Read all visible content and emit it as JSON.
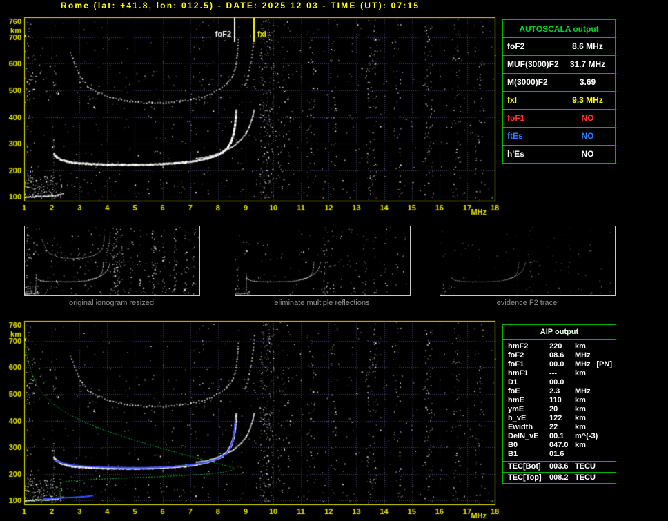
{
  "title": "Rome (lat: +41.8, lon: 012.5) - DATE: 2025 12 03 - TIME (UT): 07:15",
  "colors": {
    "background": "#000000",
    "title": "#ffff00",
    "axis": "#e8e800",
    "grid": "#3f3f6e",
    "trace_white": "#ffffff",
    "profile_green": "#00bb33",
    "restored_blue": "#3a4cff",
    "table_green": "#00b400",
    "value_red": "#ff3232",
    "value_blue": "#2f7fff",
    "value_yellow": "#ffff00",
    "caption_gray": "#8f8f8f"
  },
  "captions": [
    "original ionogram resized",
    "eliminate multiple reflections",
    "evidence F2 trace"
  ],
  "autoscala_table": {
    "title": "AUTOSCALA output",
    "rows": [
      {
        "label": "foF2",
        "value": "8.6 MHz",
        "color": "#ffffff"
      },
      {
        "label": "MUF(3000)F2",
        "value": "31.7 MHz",
        "color": "#ffffff"
      },
      {
        "label": "M(3000)F2",
        "value": "3.69",
        "color": "#ffffff"
      },
      {
        "label": "fxI",
        "value": "9.3 MHz",
        "color": "#ffff00"
      },
      {
        "label": "foF1",
        "value": "NO",
        "color": "#ff3232"
      },
      {
        "label": "ftEs",
        "value": "NO",
        "color": "#2f7fff"
      },
      {
        "label": "h'Es",
        "value": "NO",
        "color": "#ffffff"
      }
    ]
  },
  "aip_table": {
    "title": "AIP output",
    "rows": [
      {
        "name": "hmF2",
        "value": "220",
        "unit": "km"
      },
      {
        "name": "foF2",
        "value": "08.6",
        "unit": "MHz"
      },
      {
        "name": "foF1",
        "value": "00.0",
        "unit": "MHz",
        "extra": "[PN]"
      },
      {
        "name": "hmF1",
        "value": "---",
        "unit": "km"
      },
      {
        "name": "D1",
        "value": "00.0",
        "unit": ""
      },
      {
        "name": "foE",
        "value": "2.3",
        "unit": "MHz"
      },
      {
        "name": "hmE",
        "value": "110",
        "unit": "km"
      },
      {
        "name": "ymE",
        "value": "20",
        "unit": "km"
      },
      {
        "name": "h_vE",
        "value": "122",
        "unit": "km"
      },
      {
        "name": "Ewidth",
        "value": "22",
        "unit": "km"
      },
      {
        "name": "DelN_vE",
        "value": "00.1",
        "unit": "m^(-3)"
      },
      {
        "name": "B0",
        "value": "047.0",
        "unit": "km"
      },
      {
        "name": "B1",
        "value": "01.6",
        "unit": ""
      }
    ],
    "tec_rows": [
      {
        "name": "TEC[Bot]",
        "value": "003.6",
        "unit": "TECU"
      },
      {
        "name": "TEC[Top]",
        "value": "008.2",
        "unit": "TECU"
      }
    ]
  },
  "chart_data": {
    "type": "scatter",
    "title": "ionogram (virtual height vs frequency)",
    "x_label": "MHz",
    "y_label": "km",
    "x_range": [
      1,
      18
    ],
    "y_range": [
      85,
      775
    ],
    "x_ticks": [
      1,
      2,
      3,
      4,
      5,
      6,
      7,
      8,
      9,
      10,
      11,
      12,
      13,
      14,
      15,
      16,
      17,
      18
    ],
    "y_ticks": [
      760,
      700,
      600,
      500,
      400,
      300,
      200,
      100
    ],
    "y_grid": [
      100,
      200,
      300,
      400,
      500,
      600,
      700
    ],
    "markers": [
      {
        "label": "foF2",
        "x": 8.6,
        "color": "#ffffff",
        "side": "left"
      },
      {
        "label": "fxI",
        "x": 9.3,
        "color": "#ffff00",
        "side": "right"
      }
    ],
    "traces": [
      {
        "id": "e-trace",
        "color": "#ffffff",
        "size": 2,
        "step": 2,
        "jitter": 0.7,
        "points": [
          [
            1.0,
            102
          ],
          [
            1.35,
            103
          ],
          [
            1.7,
            105
          ],
          [
            2.0,
            107
          ],
          [
            2.2,
            109
          ],
          [
            2.4,
            114
          ]
        ]
      },
      {
        "id": "ef-cusp",
        "color": "#ffffff",
        "size": 1,
        "step": 4,
        "jitter": 1.2,
        "fade": 0.85,
        "points": [
          [
            2.02,
            118
          ],
          [
            2.03,
            150
          ],
          [
            2.05,
            185
          ],
          [
            2.06,
            222
          ],
          [
            2.06,
            255
          ],
          [
            2.07,
            288
          ],
          [
            2.04,
            312
          ]
        ]
      },
      {
        "id": "f-trace-o",
        "color": "#ffffff",
        "size": 3,
        "step": 2,
        "jitter": 0.7,
        "points": [
          [
            2.05,
            265
          ],
          [
            2.15,
            252
          ],
          [
            2.3,
            243
          ],
          [
            2.5,
            236
          ],
          [
            2.8,
            231
          ],
          [
            3.2,
            228
          ],
          [
            3.6,
            226
          ],
          [
            4.0,
            225
          ],
          [
            4.5,
            224
          ],
          [
            5.0,
            224
          ],
          [
            5.5,
            225
          ],
          [
            6.0,
            227
          ],
          [
            6.4,
            229
          ],
          [
            6.8,
            233
          ],
          [
            7.2,
            239
          ],
          [
            7.6,
            248
          ],
          [
            7.9,
            259
          ],
          [
            8.15,
            272
          ],
          [
            8.33,
            290
          ],
          [
            8.45,
            312
          ],
          [
            8.53,
            340
          ],
          [
            8.58,
            372
          ],
          [
            8.61,
            402
          ],
          [
            8.63,
            428
          ]
        ]
      },
      {
        "id": "f-trace-x",
        "color": "#ffffff",
        "size": 2,
        "step": 2,
        "jitter": 0.7,
        "points": [
          [
            7.2,
            246
          ],
          [
            7.7,
            256
          ],
          [
            8.1,
            269
          ],
          [
            8.45,
            287
          ],
          [
            8.75,
            311
          ],
          [
            9.0,
            341
          ],
          [
            9.14,
            373
          ],
          [
            9.23,
            403
          ],
          [
            9.29,
            432
          ]
        ]
      },
      {
        "id": "hop2-tail",
        "color": "#ffffff",
        "size": 2,
        "step": 5,
        "jitter": 1.4,
        "fade": 0.8,
        "points": [
          [
            2.65,
            645
          ],
          [
            2.8,
            602
          ],
          [
            2.95,
            566
          ],
          [
            3.1,
            539
          ],
          [
            3.3,
            516
          ]
        ]
      },
      {
        "id": "hop2",
        "color": "#ffffff",
        "size": 2,
        "step": 4,
        "jitter": 1.2,
        "fade": 0.85,
        "points": [
          [
            3.3,
            516
          ],
          [
            3.7,
            492
          ],
          [
            4.1,
            476
          ],
          [
            4.6,
            464
          ],
          [
            5.1,
            458
          ],
          [
            5.6,
            456
          ],
          [
            6.1,
            457
          ],
          [
            6.6,
            461
          ],
          [
            7.0,
            468
          ],
          [
            7.4,
            478
          ],
          [
            7.75,
            491
          ],
          [
            8.05,
            507
          ],
          [
            8.3,
            527
          ],
          [
            8.5,
            554
          ],
          [
            8.62,
            592
          ],
          [
            8.68,
            642
          ],
          [
            8.72,
            702
          ]
        ]
      },
      {
        "id": "hop2-x",
        "color": "#ffffff",
        "size": 2,
        "step": 5,
        "jitter": 1.4,
        "fade": 0.8,
        "points": [
          [
            8.95,
            520
          ],
          [
            9.08,
            562
          ],
          [
            9.18,
            612
          ],
          [
            9.25,
            667
          ],
          [
            9.3,
            722
          ]
        ]
      },
      {
        "id": "profile-green",
        "render": "line",
        "color": "#00bb33",
        "size": 1,
        "dash": [
          2,
          2
        ],
        "points": [
          [
            1.02,
            700
          ],
          [
            1.1,
            640
          ],
          [
            1.25,
            585
          ],
          [
            1.45,
            535
          ],
          [
            1.75,
            492
          ],
          [
            2.1,
            458
          ],
          [
            2.6,
            424
          ],
          [
            3.2,
            394
          ],
          [
            3.9,
            364
          ],
          [
            4.7,
            336
          ],
          [
            5.5,
            310
          ],
          [
            6.3,
            286
          ],
          [
            7.1,
            263
          ],
          [
            7.8,
            244
          ],
          [
            8.3,
            230
          ],
          [
            8.55,
            223
          ],
          [
            8.6,
            220
          ],
          [
            8.5,
            213
          ],
          [
            8.2,
            206
          ],
          [
            7.6,
            199
          ],
          [
            6.8,
            194
          ],
          [
            5.8,
            189
          ],
          [
            4.8,
            185
          ],
          [
            3.9,
            181
          ],
          [
            3.2,
            177
          ],
          [
            2.7,
            174
          ],
          [
            2.45,
            170
          ],
          [
            2.33,
            163
          ],
          [
            2.3,
            152
          ],
          [
            2.29,
            138
          ],
          [
            2.3,
            124
          ],
          [
            2.28,
            116
          ],
          [
            2.2,
            111
          ],
          [
            2.0,
            107
          ],
          [
            1.7,
            103
          ],
          [
            1.4,
            99
          ],
          [
            1.15,
            95
          ],
          [
            1.02,
            92
          ]
        ]
      },
      {
        "id": "restored-blue",
        "render": "line",
        "color": "#3a4cff",
        "size": 2,
        "points": [
          [
            2.1,
            252
          ],
          [
            2.4,
            240
          ],
          [
            2.8,
            232
          ],
          [
            3.3,
            228
          ],
          [
            3.9,
            225
          ],
          [
            4.6,
            223
          ],
          [
            5.3,
            223
          ],
          [
            6.0,
            225
          ],
          [
            6.6,
            229
          ],
          [
            7.1,
            235
          ],
          [
            7.6,
            244
          ],
          [
            8.0,
            257
          ],
          [
            8.3,
            275
          ],
          [
            8.45,
            298
          ],
          [
            8.55,
            330
          ],
          [
            8.6,
            368
          ],
          [
            8.63,
            405
          ]
        ]
      },
      {
        "id": "restored-blue-e",
        "render": "line",
        "color": "#3a4cff",
        "size": 2,
        "points": [
          [
            1.7,
            106
          ],
          [
            2.2,
            109
          ],
          [
            2.7,
            111
          ],
          [
            3.2,
            114
          ],
          [
            3.5,
            118
          ]
        ]
      }
    ],
    "noise": {
      "seed": 1337,
      "bands": [
        {
          "x0": 1.0,
          "x1": 18.0,
          "y0": 90,
          "y1": 770,
          "n": 420
        },
        {
          "x0": 9.5,
          "x1": 10.0,
          "y0": 90,
          "y1": 770,
          "n": 230
        },
        {
          "x0": 10.05,
          "x1": 10.6,
          "y0": 90,
          "y1": 770,
          "n": 70
        },
        {
          "x0": 11.2,
          "x1": 11.5,
          "y0": 90,
          "y1": 770,
          "n": 55
        },
        {
          "x0": 12.05,
          "x1": 12.3,
          "y0": 90,
          "y1": 770,
          "n": 40
        },
        {
          "x0": 13.35,
          "x1": 13.75,
          "y0": 90,
          "y1": 770,
          "n": 110
        },
        {
          "x0": 14.35,
          "x1": 14.6,
          "y0": 90,
          "y1": 770,
          "n": 45
        },
        {
          "x0": 15.45,
          "x1": 15.75,
          "y0": 90,
          "y1": 770,
          "n": 85
        },
        {
          "x0": 16.45,
          "x1": 16.75,
          "y0": 90,
          "y1": 770,
          "n": 60
        },
        {
          "x0": 17.25,
          "x1": 17.55,
          "y0": 90,
          "y1": 770,
          "n": 45
        },
        {
          "x0": 1.0,
          "x1": 2.35,
          "y0": 93,
          "y1": 185,
          "n": 150
        },
        {
          "x0": 1.0,
          "x1": 1.3,
          "y0": 90,
          "y1": 770,
          "n": 55
        },
        {
          "x0": 1.05,
          "x1": 2.4,
          "y0": 460,
          "y1": 640,
          "n": 45
        },
        {
          "x0": 3.0,
          "x1": 9.4,
          "y0": 430,
          "y1": 560,
          "n": 60
        },
        {
          "x0": 2.5,
          "x1": 9.0,
          "y0": 95,
          "y1": 200,
          "n": 40
        }
      ]
    }
  },
  "plots": {
    "top": {
      "canvas": "plot-top",
      "axes": true,
      "markers": true,
      "noise": 1,
      "dot_scale": 1,
      "dim": 1,
      "traces": [
        "e-trace",
        "ef-cusp",
        "f-trace-o",
        "f-trace-x",
        "hop2-tail",
        "hop2",
        "hop2-x"
      ]
    },
    "bottom": {
      "canvas": "plot-bottom",
      "axes": true,
      "markers": false,
      "noise": 1,
      "dot_scale": 1,
      "dim": 1,
      "traces": [
        "e-trace",
        "ef-cusp",
        "f-trace-o",
        "f-trace-x",
        "hop2-tail",
        "hop2",
        "hop2-x",
        "profile-green",
        "restored-blue",
        "restored-blue-e"
      ]
    },
    "thumb1": {
      "canvas": "thumb1-canvas",
      "axes": false,
      "markers": false,
      "noise": 0.35,
      "dot_scale": 0.45,
      "dim": 1,
      "traces": [
        "e-trace",
        "ef-cusp",
        "f-trace-o",
        "f-trace-x",
        "hop2-tail",
        "hop2",
        "hop2-x"
      ]
    },
    "thumb2": {
      "canvas": "thumb2-canvas",
      "axes": false,
      "markers": false,
      "noise": 0.15,
      "dot_scale": 0.45,
      "dim": 0.95,
      "traces": [
        "e-trace",
        "ef-cusp",
        "f-trace-o",
        "f-trace-x"
      ]
    },
    "thumb3": {
      "canvas": "thumb3-canvas",
      "axes": false,
      "markers": false,
      "noise": 0.08,
      "dot_scale": 0.45,
      "dim": 0.55,
      "traces": [
        "f-trace-o",
        "f-trace-x"
      ]
    }
  }
}
